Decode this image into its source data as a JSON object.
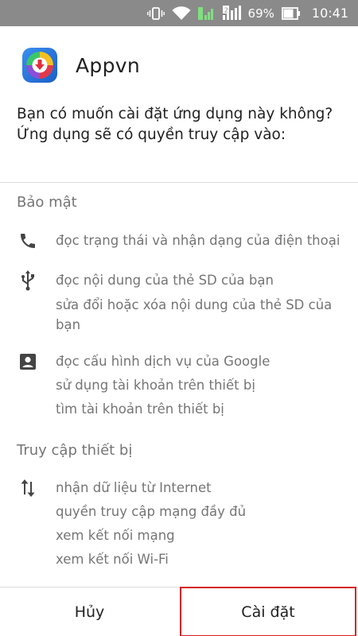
{
  "status_bar": {
    "battery_percent": "69%",
    "time": "10:41",
    "icons": [
      "vibrate-icon",
      "wifi-icon",
      "signal-icon",
      "sim2-signal-icon",
      "battery-icon"
    ]
  },
  "app": {
    "name": "Appvn",
    "icon": "appvn-logo-icon"
  },
  "question": "Bạn có muốn cài đặt ứng dụng này không? Ứng dụng sẽ có quyền truy cập vào:",
  "sections": [
    {
      "title": "Bảo mật",
      "groups": [
        {
          "icon": "phone-icon",
          "lines": [
            "đọc trạng thái và nhận dạng của điện thoại"
          ]
        },
        {
          "icon": "usb-icon",
          "lines": [
            "đọc nội dung của thẻ SD của bạn",
            "sửa đổi hoặc xóa nội dung của thẻ SD của bạn"
          ]
        },
        {
          "icon": "account-box-icon",
          "lines": [
            "đọc cấu hình dịch vụ của Google",
            "sử dụng tài khoản trên thiết bị",
            "tìm tài khoản trên thiết bị"
          ]
        }
      ]
    },
    {
      "title": "Truy cập thiết bị",
      "groups": [
        {
          "icon": "network-arrows-icon",
          "lines": [
            "nhận dữ liệu từ Internet",
            "quyền truy cập mạng đầy đủ",
            "xem kết nối mạng",
            "xem kết nối Wi-Fi"
          ]
        }
      ]
    }
  ],
  "buttons": {
    "cancel": "Hủy",
    "install": "Cài đặt"
  },
  "colors": {
    "status_bar": "#8a8a8a",
    "install_highlight": "#d82020",
    "secondary_text": "#757575"
  }
}
